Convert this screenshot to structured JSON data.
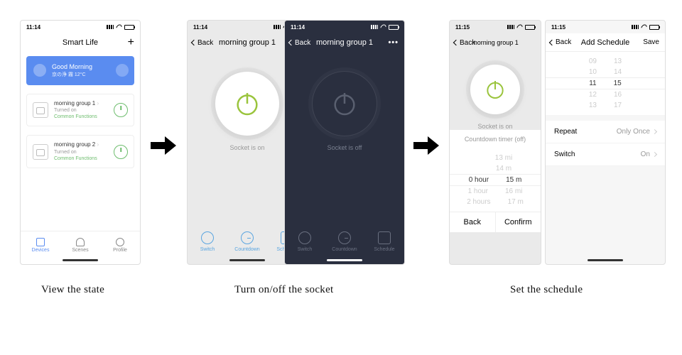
{
  "captions": {
    "view": "View the state",
    "toggle": "Turn on/off the socket",
    "schedule": "Set the schedule"
  },
  "status": {
    "time_a": "11:14",
    "time_b": "11:15"
  },
  "home": {
    "title": "Smart Life",
    "banner": {
      "greeting": "Good Morning",
      "sub": "京の浄 霧 12°C"
    },
    "devices": [
      {
        "name": "morning group 1",
        "status": "Turned on",
        "common": "Common Functions"
      },
      {
        "name": "morning group 2",
        "status": "Turned on",
        "common": "Common Functions"
      }
    ],
    "tabs": {
      "devices": "Devices",
      "scenes": "Scenes",
      "profile": "Profile"
    }
  },
  "switch": {
    "back": "Back",
    "title": "morning group 1",
    "on_label": "Socket is on",
    "off_label": "Socket is off",
    "tabs": {
      "switch": "Switch",
      "countdown": "Countdown",
      "schedule": "Schedule"
    }
  },
  "countdown": {
    "title": "Countdown timer (off)",
    "left": [
      "",
      "0 hour",
      "1 hour",
      "2 hours"
    ],
    "right": [
      "13 mi",
      "14 m",
      "15 m",
      "16 mi",
      "17 m"
    ],
    "back": "Back",
    "confirm": "Confirm"
  },
  "addSchedule": {
    "back": "Back",
    "title": "Add Schedule",
    "save": "Save",
    "hours": [
      "09",
      "10",
      "11",
      "12",
      "13"
    ],
    "mins": [
      "13",
      "14",
      "15",
      "16",
      "17"
    ],
    "repeat_label": "Repeat",
    "repeat_val": "Only Once",
    "switch_label": "Switch",
    "switch_val": "On"
  }
}
